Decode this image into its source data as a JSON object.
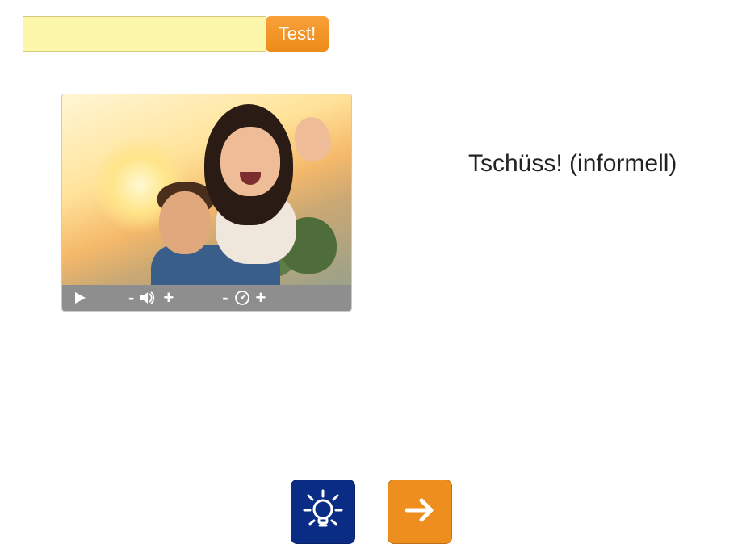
{
  "input": {
    "value": "",
    "placeholder": ""
  },
  "buttons": {
    "test_label": "Test!",
    "hint": "hint",
    "next": "next"
  },
  "prompt": {
    "text": "Tschüss! (informell)"
  },
  "media": {
    "alt": "photo-couple-waving",
    "controls": {
      "play": "play",
      "vol_minus": "-",
      "vol_plus": "+",
      "speed_minus": "-",
      "speed_plus": "+"
    }
  },
  "colors": {
    "accent": "#ee8e1e",
    "primary": "#0a2c85",
    "input_bg": "#fdf7ab"
  }
}
